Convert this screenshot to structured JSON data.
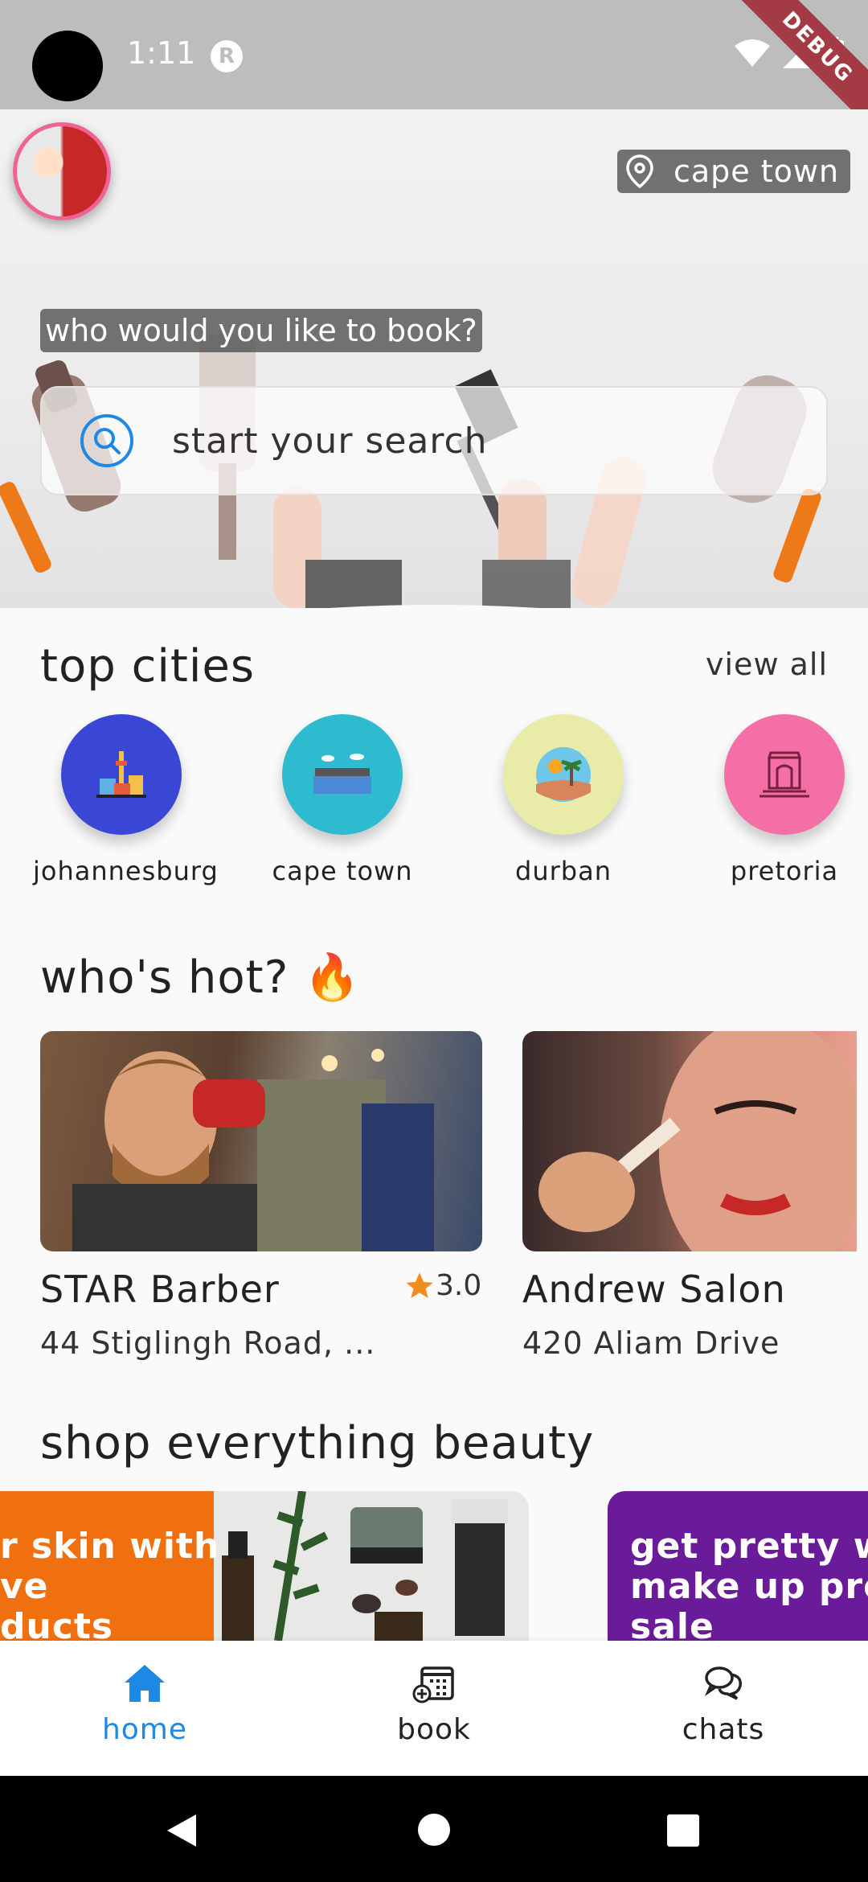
{
  "status_bar": {
    "time": "1:11",
    "debug_label": "DEBUG"
  },
  "header": {
    "location": "cape town",
    "prompt": "who would you like to book?"
  },
  "search": {
    "placeholder": "start your search"
  },
  "top_cities": {
    "title": "top cities",
    "view_all": "view all",
    "items": [
      {
        "label": "johannesburg",
        "color": "#3a47d5"
      },
      {
        "label": "cape town",
        "color": "#2ebbd0"
      },
      {
        "label": "durban",
        "color": "#e9eba8"
      },
      {
        "label": "pretoria",
        "color": "#f36fa6"
      }
    ]
  },
  "whos_hot": {
    "title": "who's hot? 🔥",
    "items": [
      {
        "name": "STAR Barber",
        "address": "44 Stiglingh Road, ...",
        "rating": "3.0"
      },
      {
        "name": "Andrew Salon",
        "address": "420 Aliam Drive"
      }
    ]
  },
  "shop": {
    "title": "shop everything beauty",
    "banners": [
      {
        "text_lines": [
          "r skin with",
          "ve",
          "ducts"
        ],
        "color": "#f07010"
      },
      {
        "text_lines": [
          "get pretty wit",
          "make up proc",
          "sale"
        ],
        "color": "#6a1b9a"
      }
    ]
  },
  "bottom_nav": {
    "active_color": "#1e88e5",
    "items": [
      {
        "label": "home",
        "icon": "home-icon"
      },
      {
        "label": "book",
        "icon": "calendar-add-icon"
      },
      {
        "label": "chats",
        "icon": "chat-icon"
      }
    ]
  }
}
